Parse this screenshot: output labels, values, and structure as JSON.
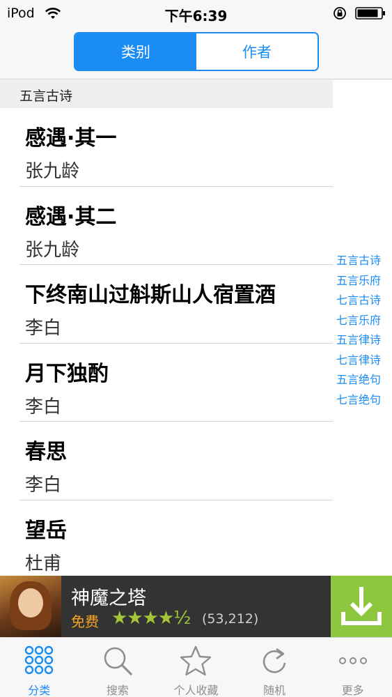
{
  "status_bar": {
    "device": "iPod",
    "time": "下午6:39"
  },
  "segmented": {
    "tab_category": "类别",
    "tab_author": "作者"
  },
  "section": {
    "title": "五言古诗"
  },
  "poems": [
    {
      "title": "感遇·其一",
      "author": "张九龄"
    },
    {
      "title": "感遇·其二",
      "author": "张九龄"
    },
    {
      "title": "下终南山过斛斯山人宿置酒",
      "author": "李白"
    },
    {
      "title": "月下独酌",
      "author": "李白"
    },
    {
      "title": "春思",
      "author": "李白"
    },
    {
      "title": "望岳",
      "author": "杜甫"
    }
  ],
  "index": [
    "五言古诗",
    "五言乐府",
    "七言古诗",
    "七言乐府",
    "五言律诗",
    "七言律诗",
    "五言绝句",
    "七言绝句"
  ],
  "ad": {
    "title": "神魔之塔",
    "price": "免费",
    "rating_stars": "★★★★½",
    "rating": 4.5,
    "rating_count": "(53,212)"
  },
  "tabbar": {
    "categories": "分类",
    "search": "搜索",
    "favorites": "个人收藏",
    "random": "随机",
    "more": "更多"
  },
  "colors": {
    "accent": "#1a8cf3",
    "ad_download": "#8dc63f",
    "ad_background": "#333333"
  }
}
